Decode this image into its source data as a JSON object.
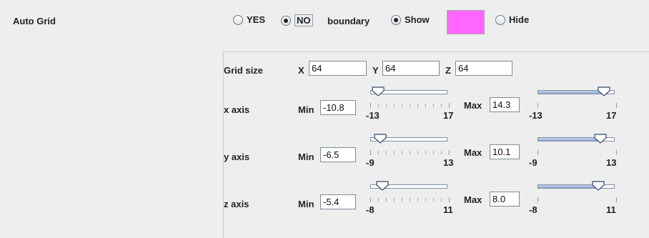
{
  "title": "Auto Grid",
  "auto_grid": {
    "yes_label": "YES",
    "no_label": "NO",
    "selected": "NO"
  },
  "boundary": {
    "label": "boundary",
    "show_label": "Show",
    "hide_label": "Hide",
    "selected": "Show",
    "color": "#ff66ff"
  },
  "grid_size": {
    "label": "Grid size",
    "x_label": "X",
    "x_value": "64",
    "y_label": "Y",
    "y_value": "64",
    "z_label": "Z",
    "z_value": "64"
  },
  "axes": [
    {
      "label": "x axis",
      "min_label": "Min",
      "min_value": "-10.8",
      "max_label": "Max",
      "max_value": "14.3",
      "range_min": "-13",
      "range_max": "17",
      "min_fraction": 0.08,
      "max_fraction": 0.92
    },
    {
      "label": "y axis",
      "min_label": "Min",
      "min_value": "-6.5",
      "max_label": "Max",
      "max_value": "10.1",
      "range_min": "-9",
      "range_max": "13",
      "min_fraction": 0.11,
      "max_fraction": 0.87
    },
    {
      "label": "z axis",
      "min_label": "Min",
      "min_value": "-5.4",
      "max_label": "Max",
      "max_value": "8.0",
      "range_min": "-8",
      "range_max": "11",
      "min_fraction": 0.14,
      "max_fraction": 0.84
    }
  ]
}
